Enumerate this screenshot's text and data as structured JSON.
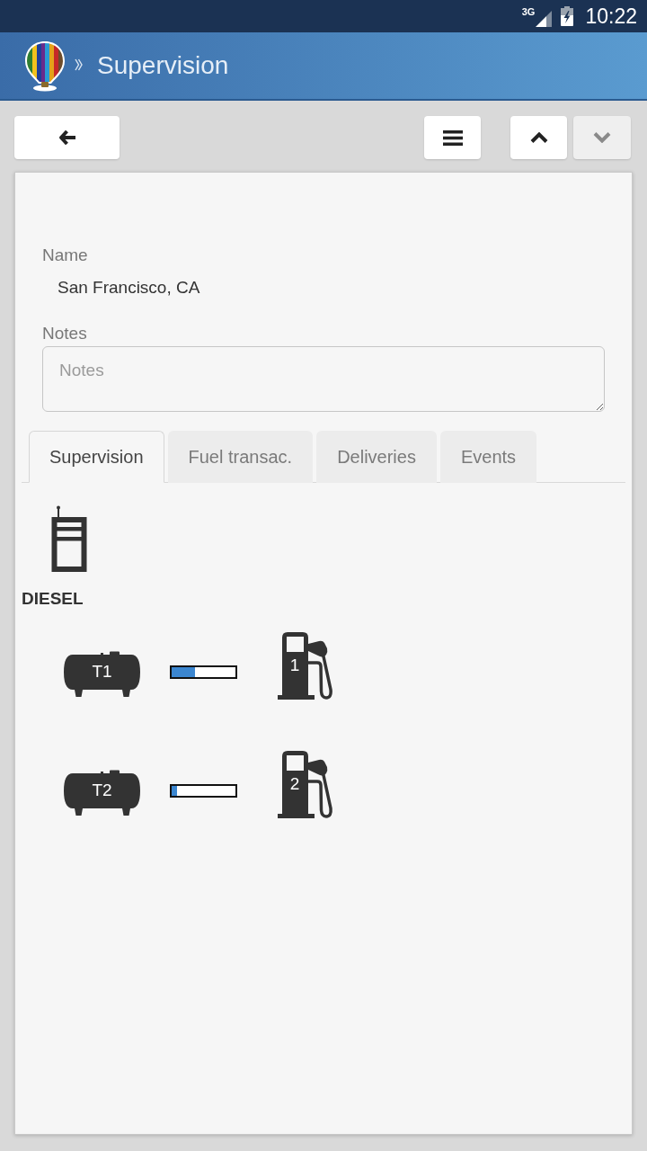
{
  "status_bar": {
    "network": "3G",
    "time": "10:22"
  },
  "header": {
    "title": "Supervision"
  },
  "toolbar": [
    {
      "kind": "back",
      "disabled": false
    },
    {
      "kind": "menu",
      "disabled": false
    },
    {
      "kind": "up",
      "disabled": false
    },
    {
      "kind": "down",
      "disabled": true
    }
  ],
  "form": {
    "name": {
      "label": "Name",
      "value": "San Francisco, CA"
    },
    "notes": {
      "label": "Notes",
      "placeholder": "Notes"
    }
  },
  "tabs": [
    {
      "label": "Supervision",
      "selected": true
    },
    {
      "label": "Fuel transac.",
      "selected": false
    },
    {
      "label": "Deliveries",
      "selected": false
    },
    {
      "label": "Events",
      "selected": false
    }
  ],
  "supervision": {
    "product": "DIESEL",
    "rows": [
      {
        "tank": "T1",
        "level": 0.37,
        "pump": "1"
      },
      {
        "tank": "T2",
        "level": 0.08,
        "pump": "2"
      }
    ]
  }
}
